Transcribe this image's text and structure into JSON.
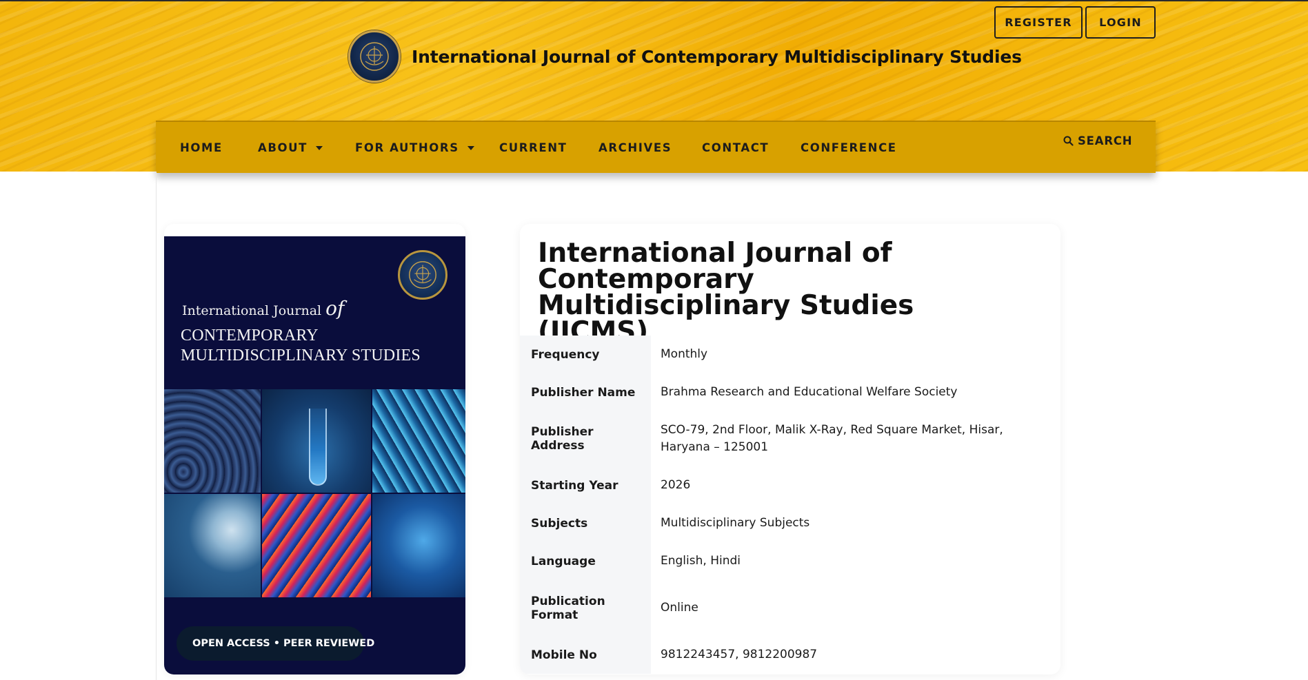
{
  "site": {
    "title": "International Journal of Contemporary Multidisciplinary Studies"
  },
  "auth": {
    "register_label": "REGISTER",
    "login_label": "LOGIN"
  },
  "nav": {
    "items": [
      {
        "label": "HOME",
        "has_dropdown": false
      },
      {
        "label": "ABOUT",
        "has_dropdown": true
      },
      {
        "label": "FOR AUTHORS",
        "has_dropdown": true
      },
      {
        "label": "CURRENT",
        "has_dropdown": false
      },
      {
        "label": "ARCHIVES",
        "has_dropdown": false
      },
      {
        "label": "CONTACT",
        "has_dropdown": false
      },
      {
        "label": "CONFERENCE",
        "has_dropdown": false
      }
    ],
    "search_label": "SEARCH",
    "search_icon": "search-icon"
  },
  "cover": {
    "line1_prefix": "International Journal",
    "line1_of": "of",
    "line2": "CONTEMPORARY",
    "line3": "MULTIDISCIPLINARY STUDIES",
    "badge": "OPEN ACCESS • PEER REVIEWED"
  },
  "journal": {
    "heading": "International Journal of Contemporary Multidisciplinary Studies (IJCMS)",
    "details": [
      {
        "key": "Frequency",
        "value": "Monthly"
      },
      {
        "key": "Publisher Name",
        "value": "Brahma Research and Educational Welfare Society"
      },
      {
        "key": "Publisher Address",
        "value": "SCO-79, 2nd Floor, Malik X-Ray, Red Square Market, Hisar, Haryana – 125001"
      },
      {
        "key": "Starting Year",
        "value": "2026"
      },
      {
        "key": "Subjects",
        "value": "Multidisciplinary Subjects"
      },
      {
        "key": "Language",
        "value": "English, Hindi"
      },
      {
        "key": "Publication Format",
        "value": "Online"
      },
      {
        "key": "Mobile No",
        "value": "9812243457, 9812200987"
      }
    ]
  },
  "colors": {
    "header_gold": "#f3b60c",
    "nav_gold": "#d8a100",
    "cover_navy": "#0a0d3c"
  }
}
